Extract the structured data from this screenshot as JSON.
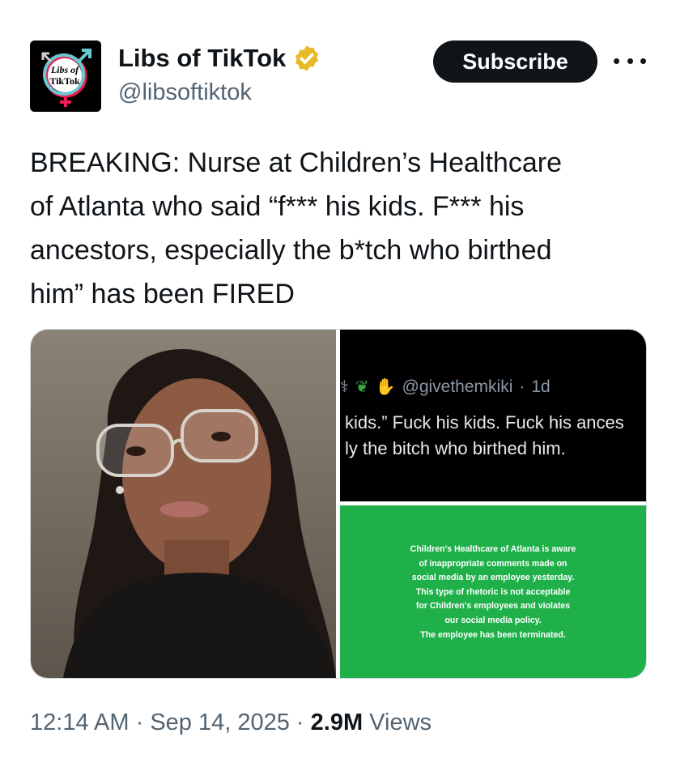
{
  "account": {
    "display_name": "Libs of TikTok",
    "handle": "@libsoftiktok",
    "logo_text_line1": "Libs of",
    "logo_text_line2": "TikTok",
    "verified_color": "#e8b928"
  },
  "actions": {
    "subscribe_label": "Subscribe",
    "more_icon": "more-horizontal-icon"
  },
  "tweet": {
    "text": "BREAKING: Nurse at Children’s Healthcare\nof Atlanta who said “f*** his kids. F*** his\nancestors, especially the b*tch who birthed\nhim” has been FIRED"
  },
  "media": {
    "screenshot": {
      "handle": "@givethemkiki",
      "dot": "·",
      "age": "1d",
      "line1": "kids.” Fuck his kids. Fuck his ances",
      "line2": "ly the bitch who birthed him."
    },
    "statement": {
      "text": "Children's Healthcare of Atlanta is aware\nof inappropriate comments made on\nsocial media by an employee yesterday.\nThis type of rhetoric is not acceptable\nfor Children's employees and violates\nour social media policy.\nThe employee has been terminated.",
      "background": "#1fb04a"
    }
  },
  "meta": {
    "time": "12:14 AM",
    "sep1": " · ",
    "date": "Sep 14, 2025",
    "sep2": " · ",
    "views_count": "2.9M",
    "views_label": " Views"
  }
}
